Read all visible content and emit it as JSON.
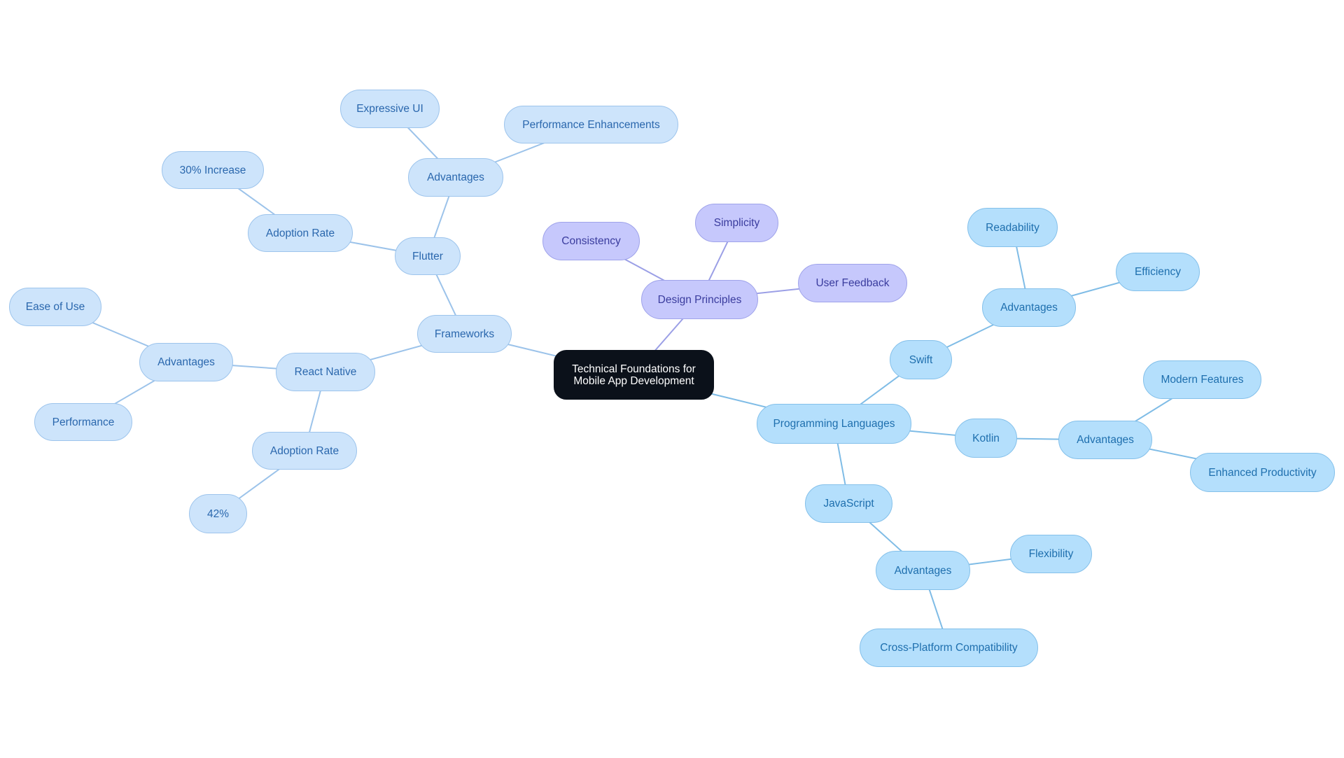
{
  "title": "Technical Foundations for Mobile App Development",
  "colors": {
    "root_fill": "#0b111a",
    "frameworks_branch": "#cde4fb",
    "frameworks_edge": "#9cc3ea",
    "design_branch": "#c6c8fc",
    "design_edge": "#9b9fe6",
    "languages_branch": "#b4dffc",
    "languages_edge": "#7fbce6"
  },
  "mindmap": {
    "root": {
      "id": "root",
      "label": "Technical Foundations for Mobile App Development"
    },
    "nodes": [
      {
        "id": "frameworks",
        "label": "Frameworks",
        "parent": "root",
        "branch": "left"
      },
      {
        "id": "flutter",
        "label": "Flutter",
        "parent": "frameworks",
        "branch": "left"
      },
      {
        "id": "flutter-adv",
        "label": "Advantages",
        "parent": "flutter",
        "branch": "left"
      },
      {
        "id": "expressive-ui",
        "label": "Expressive UI",
        "parent": "flutter-adv",
        "branch": "left"
      },
      {
        "id": "perf-enh",
        "label": "Performance Enhancements",
        "parent": "flutter-adv",
        "branch": "left"
      },
      {
        "id": "flutter-adopt",
        "label": "Adoption Rate",
        "parent": "flutter",
        "branch": "left"
      },
      {
        "id": "increase-30",
        "label": "30% Increase",
        "parent": "flutter-adopt",
        "branch": "left"
      },
      {
        "id": "react-native",
        "label": "React Native",
        "parent": "frameworks",
        "branch": "left"
      },
      {
        "id": "rn-adv",
        "label": "Advantages",
        "parent": "react-native",
        "branch": "left"
      },
      {
        "id": "ease-of-use",
        "label": "Ease of Use",
        "parent": "rn-adv",
        "branch": "left"
      },
      {
        "id": "performance",
        "label": "Performance",
        "parent": "rn-adv",
        "branch": "left"
      },
      {
        "id": "rn-adopt",
        "label": "Adoption Rate",
        "parent": "react-native",
        "branch": "left"
      },
      {
        "id": "pct-42",
        "label": "42%",
        "parent": "rn-adopt",
        "branch": "left"
      },
      {
        "id": "design",
        "label": "Design Principles",
        "parent": "root",
        "branch": "purple"
      },
      {
        "id": "consistency",
        "label": "Consistency",
        "parent": "design",
        "branch": "purple"
      },
      {
        "id": "simplicity",
        "label": "Simplicity",
        "parent": "design",
        "branch": "purple"
      },
      {
        "id": "user-feedback",
        "label": "User Feedback",
        "parent": "design",
        "branch": "purple"
      },
      {
        "id": "languages",
        "label": "Programming Languages",
        "parent": "root",
        "branch": "right"
      },
      {
        "id": "swift",
        "label": "Swift",
        "parent": "languages",
        "branch": "right"
      },
      {
        "id": "swift-adv",
        "label": "Advantages",
        "parent": "swift",
        "branch": "right"
      },
      {
        "id": "readability",
        "label": "Readability",
        "parent": "swift-adv",
        "branch": "right"
      },
      {
        "id": "efficiency",
        "label": "Efficiency",
        "parent": "swift-adv",
        "branch": "right"
      },
      {
        "id": "kotlin",
        "label": "Kotlin",
        "parent": "languages",
        "branch": "right"
      },
      {
        "id": "kotlin-adv",
        "label": "Advantages",
        "parent": "kotlin",
        "branch": "right"
      },
      {
        "id": "modern-features",
        "label": "Modern Features",
        "parent": "kotlin-adv",
        "branch": "right"
      },
      {
        "id": "enhanced-prod",
        "label": "Enhanced Productivity",
        "parent": "kotlin-adv",
        "branch": "right"
      },
      {
        "id": "javascript",
        "label": "JavaScript",
        "parent": "languages",
        "branch": "right"
      },
      {
        "id": "js-adv",
        "label": "Advantages",
        "parent": "javascript",
        "branch": "right"
      },
      {
        "id": "flexibility",
        "label": "Flexibility",
        "parent": "js-adv",
        "branch": "right"
      },
      {
        "id": "cross-platform",
        "label": "Cross-Platform Compatibility",
        "parent": "js-adv",
        "branch": "right"
      }
    ]
  }
}
